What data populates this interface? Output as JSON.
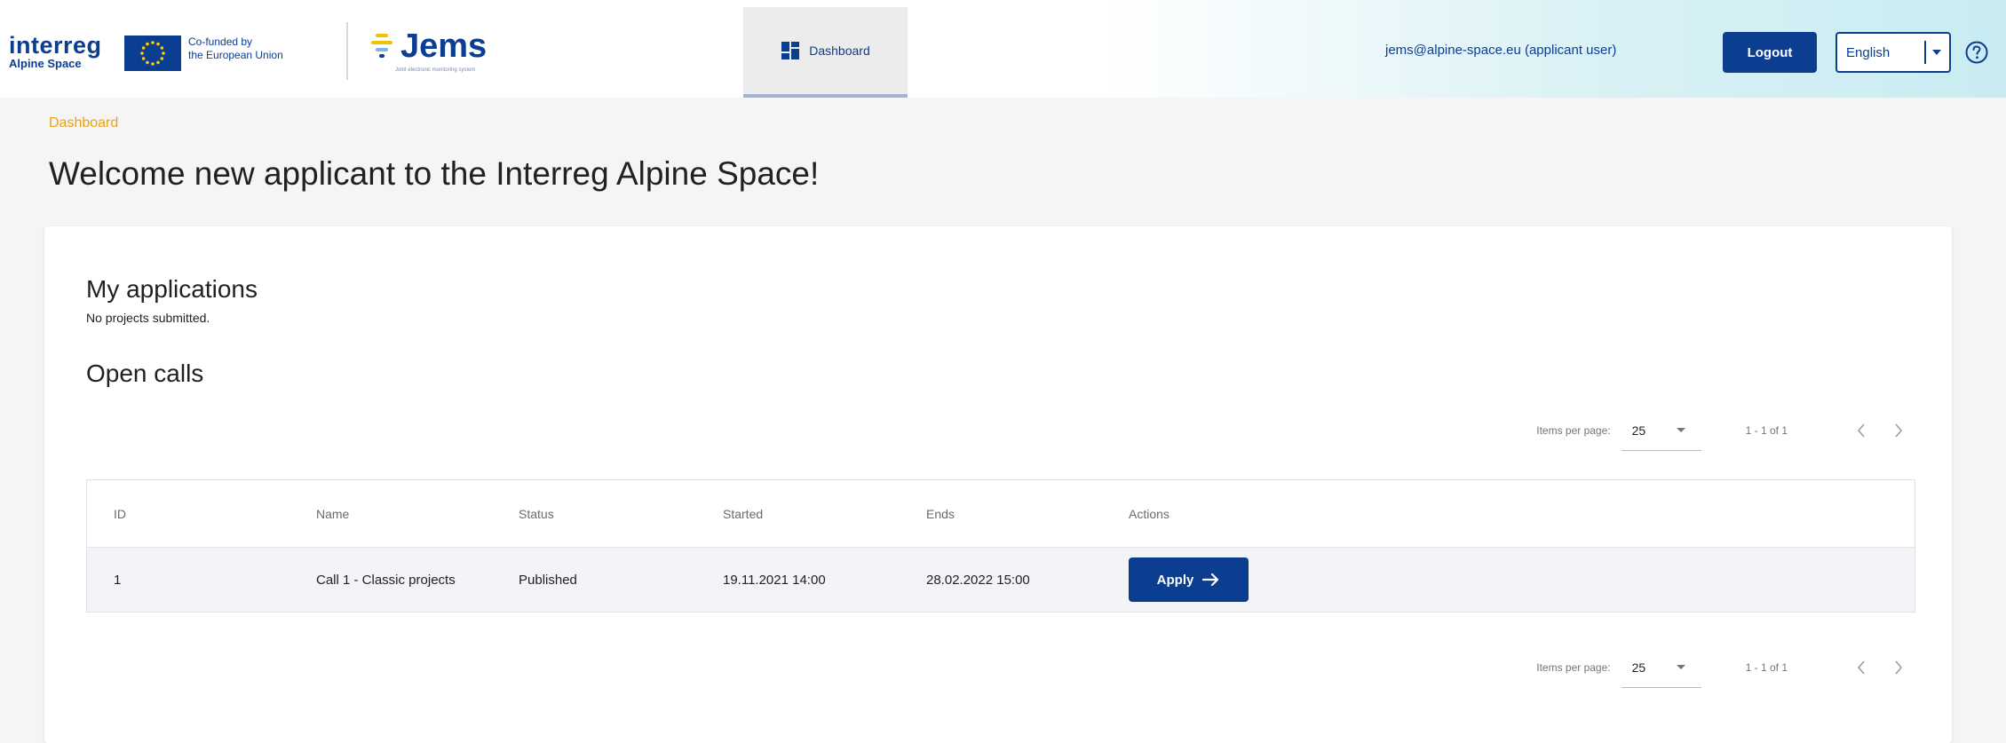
{
  "header": {
    "interreg_logo": {
      "word": "interreg",
      "sub": "Alpine Space"
    },
    "eu_text": {
      "line1": "Co-funded by",
      "line2": "the European Union"
    },
    "jems_logo": {
      "word": "Jems",
      "tagline": "Joint electronic monitoring system"
    },
    "nav": {
      "dashboard_label": "Dashboard"
    },
    "user_email": "jems@alpine-space.eu (applicant user)",
    "logout_label": "Logout",
    "language": {
      "selected": "English"
    },
    "colors": {
      "brand": "#0b3d91",
      "accent": "#e8a317"
    },
    "icons": {
      "nav": "dashboard-icon",
      "lang": "chevron-down-icon",
      "help": "help-circle-icon"
    }
  },
  "breadcrumb": "Dashboard",
  "page_title": "Welcome new applicant to the Interreg Alpine Space!",
  "applications": {
    "title": "My applications",
    "empty_text": "No projects submitted."
  },
  "open_calls": {
    "title": "Open calls",
    "paginator": {
      "items_per_page_label": "Items per page:",
      "items_per_page": "25",
      "range": "1 - 1 of 1"
    },
    "columns": {
      "id": "ID",
      "name": "Name",
      "status": "Status",
      "started": "Started",
      "ends": "Ends",
      "actions": "Actions"
    },
    "rows": [
      {
        "id": "1",
        "name": "Call 1 - Classic projects",
        "status": "Published",
        "started": "19.11.2021 14:00",
        "ends": "28.02.2022 15:00",
        "action_label": "Apply"
      }
    ]
  }
}
